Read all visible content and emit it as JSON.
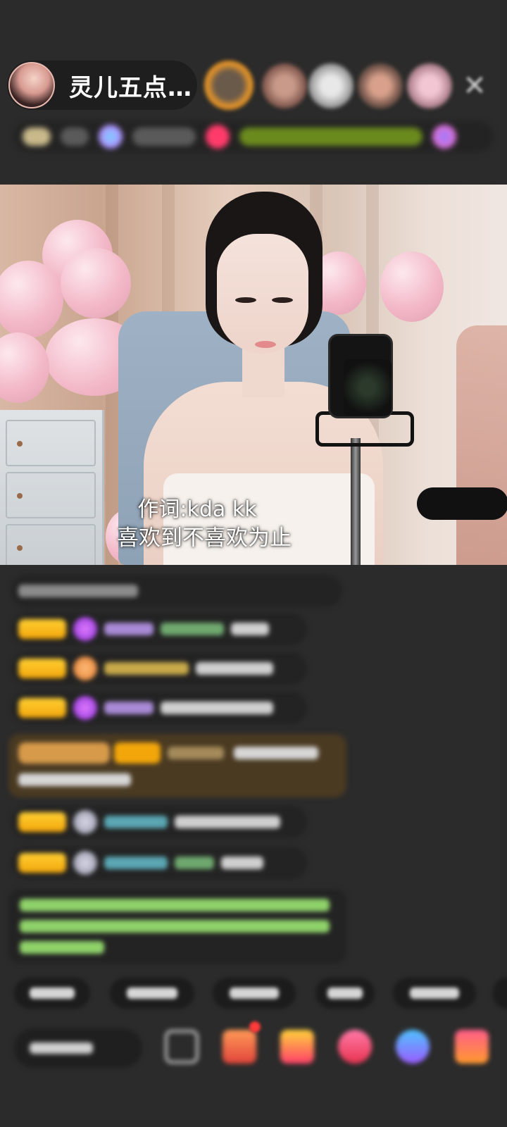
{
  "header": {
    "host_name": "灵儿五点…",
    "host_avatar_icon": "host-avatar",
    "close_icon": "close-icon",
    "close_glyph": "✕"
  },
  "video": {
    "lyric_line_1": "作词:kda kk",
    "lyric_line_2": "喜欢到不喜欢为止"
  },
  "colors": {
    "background": "#2b2b2b",
    "badge_gold": "#f2a60a",
    "highlight_row": "#4a3a22",
    "green_text": "#8fd26a"
  }
}
